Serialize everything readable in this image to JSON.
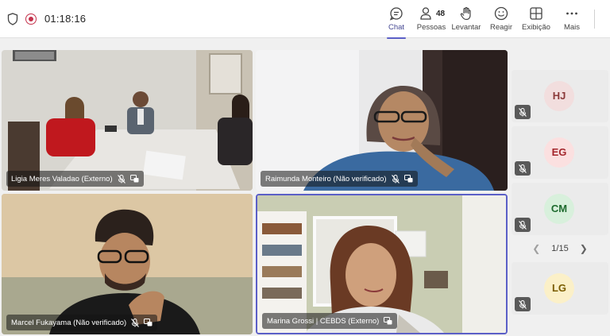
{
  "meeting": {
    "timer": "01:18:16"
  },
  "toolbar": {
    "chat": "Chat",
    "people": "Pessoas",
    "people_count": "48",
    "raise": "Levantar",
    "react": "Reagir",
    "view": "Exibição",
    "more": "Mais"
  },
  "participants": [
    {
      "name": "Ligia Meres Valadao (Externo)"
    },
    {
      "name": "Raimunda Monteiro (Não verificado)"
    },
    {
      "name": "Marcel Fukayama (Não verificado)"
    },
    {
      "name": "Marina Grossi | CEBDS (Externo)"
    }
  ],
  "side_avatars": [
    {
      "initials": "HJ",
      "bg": "#f2dede",
      "fg": "#8b3a3a"
    },
    {
      "initials": "EG",
      "bg": "#fbe0e0",
      "fg": "#a4262c"
    },
    {
      "initials": "CM",
      "bg": "#d8f0dc",
      "fg": "#1e6b2e"
    },
    {
      "initials": "LG",
      "bg": "#fbf0c8",
      "fg": "#7a5c00"
    }
  ],
  "pager": {
    "label": "1/15"
  },
  "colors": {
    "accent": "#5b5fc7",
    "recording": "#c4314b"
  }
}
